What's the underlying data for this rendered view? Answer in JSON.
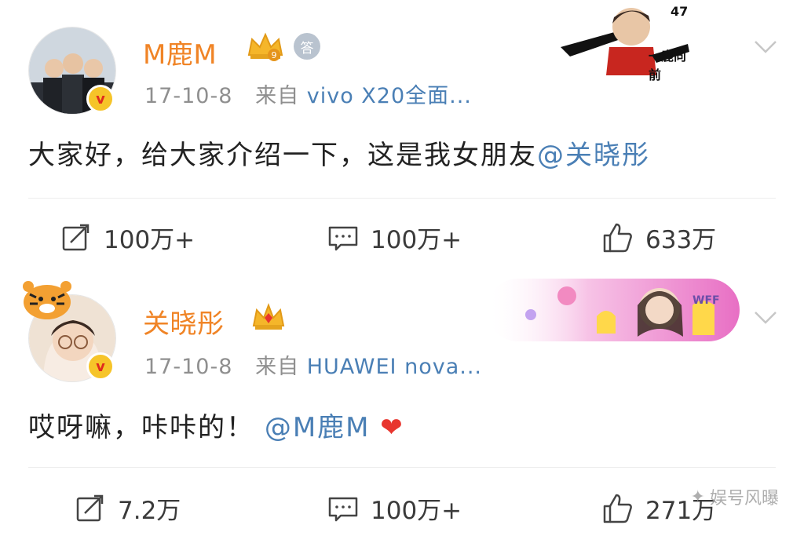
{
  "posts": [
    {
      "username": "M鹿M",
      "date": "17-10-8",
      "source_prefix": "来自",
      "source": "vivo X20全面...",
      "content": "大家好，给大家介绍一下，这是我女朋友",
      "mention": "@关晓彤",
      "repost": "100万+",
      "comment": "100万+",
      "like": "633万",
      "level_badge": "9",
      "qa_badge": "答",
      "banner": "一鹿向前",
      "banner_num": "47"
    },
    {
      "username": "关晓彤",
      "date": "17-10-8",
      "source_prefix": "来自",
      "source": "HUAWEI nova...",
      "content": "哎呀嘛，咔咔的！",
      "mention": "@M鹿M",
      "repost": "7.2万",
      "comment": "100万+",
      "like": "271万",
      "banner_label": "WFF",
      "banner_color": "#f3a3d8"
    }
  ],
  "watermark": "娱号风曝",
  "colors": {
    "username": "#f08426",
    "link": "#4a7fb5",
    "meta": "#8f8f8f",
    "heart": "#e8352e"
  }
}
